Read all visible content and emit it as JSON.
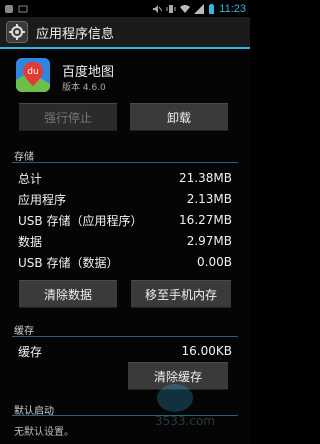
{
  "status": {
    "time": "11:23"
  },
  "actionbar": {
    "title": "应用程序信息",
    "icon": "settings-app-icon"
  },
  "app": {
    "name": "百度地图",
    "version": "版本 4.6.0",
    "icon_text": "du"
  },
  "buttons": {
    "force_stop": "强行停止",
    "uninstall": "卸载",
    "clear_data": "清除数据",
    "move_to_sd": "移至手机内存",
    "clear_cache": "清除缓存"
  },
  "storage": {
    "title": "存储",
    "rows": [
      {
        "label": "总计",
        "value": "21.38MB"
      },
      {
        "label": "应用程序",
        "value": "2.13MB"
      },
      {
        "label": "USB 存储（应用程序）",
        "value": "16.27MB"
      },
      {
        "label": "数据",
        "value": "2.97MB"
      },
      {
        "label": "USB 存储（数据）",
        "value": "0.00B"
      }
    ]
  },
  "cache": {
    "title": "缓存",
    "label": "缓存",
    "value": "16.00KB"
  },
  "default_launch": {
    "title": "默认启动",
    "text": "无默认设置。"
  },
  "watermark": {
    "text": "3533.com"
  },
  "colors": {
    "accent": "#33b5e5",
    "background": "#050505",
    "button": "#3a3a3a"
  }
}
